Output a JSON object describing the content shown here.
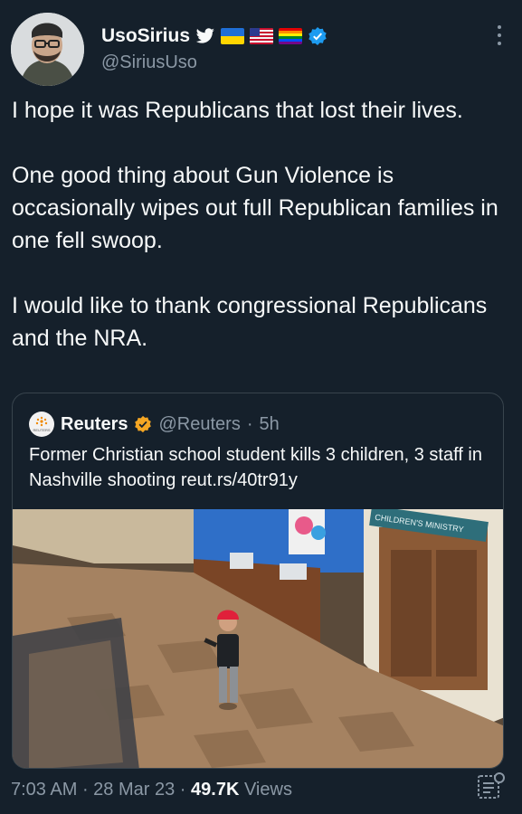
{
  "author": {
    "name": "UsoSirius",
    "handle": "@SiriusUso",
    "badges": [
      "twitter-bird-icon",
      "ukraine-flag-icon",
      "us-flag-icon",
      "rainbow-flag-icon",
      "verified-badge-icon"
    ]
  },
  "tweet": {
    "paragraphs": [
      "I hope it was Republicans that lost their lives.",
      "One good thing about Gun Violence is occasionally wipes out full Republican families in one fell swoop.",
      "I would like to thank congressional Republicans and the NRA."
    ]
  },
  "quote": {
    "logo_text": "REUTERS",
    "name": "Reuters",
    "handle": "@Reuters",
    "time": "5h",
    "text": "Former Christian school student kills 3 children, 3 staff in Nashville shooting reut.rs/40tr91y",
    "image_sign": "CHILDREN'S MINISTRY"
  },
  "footer": {
    "time": "7:03 AM",
    "date": "28 Mar 23",
    "views_count": "49.7K",
    "views_label": "Views"
  },
  "colors": {
    "background": "#15202b",
    "text": "#f7f9f9",
    "muted": "#8b98a5",
    "verified": "#1d9bf0",
    "reuters_gold": "#f5a623"
  }
}
